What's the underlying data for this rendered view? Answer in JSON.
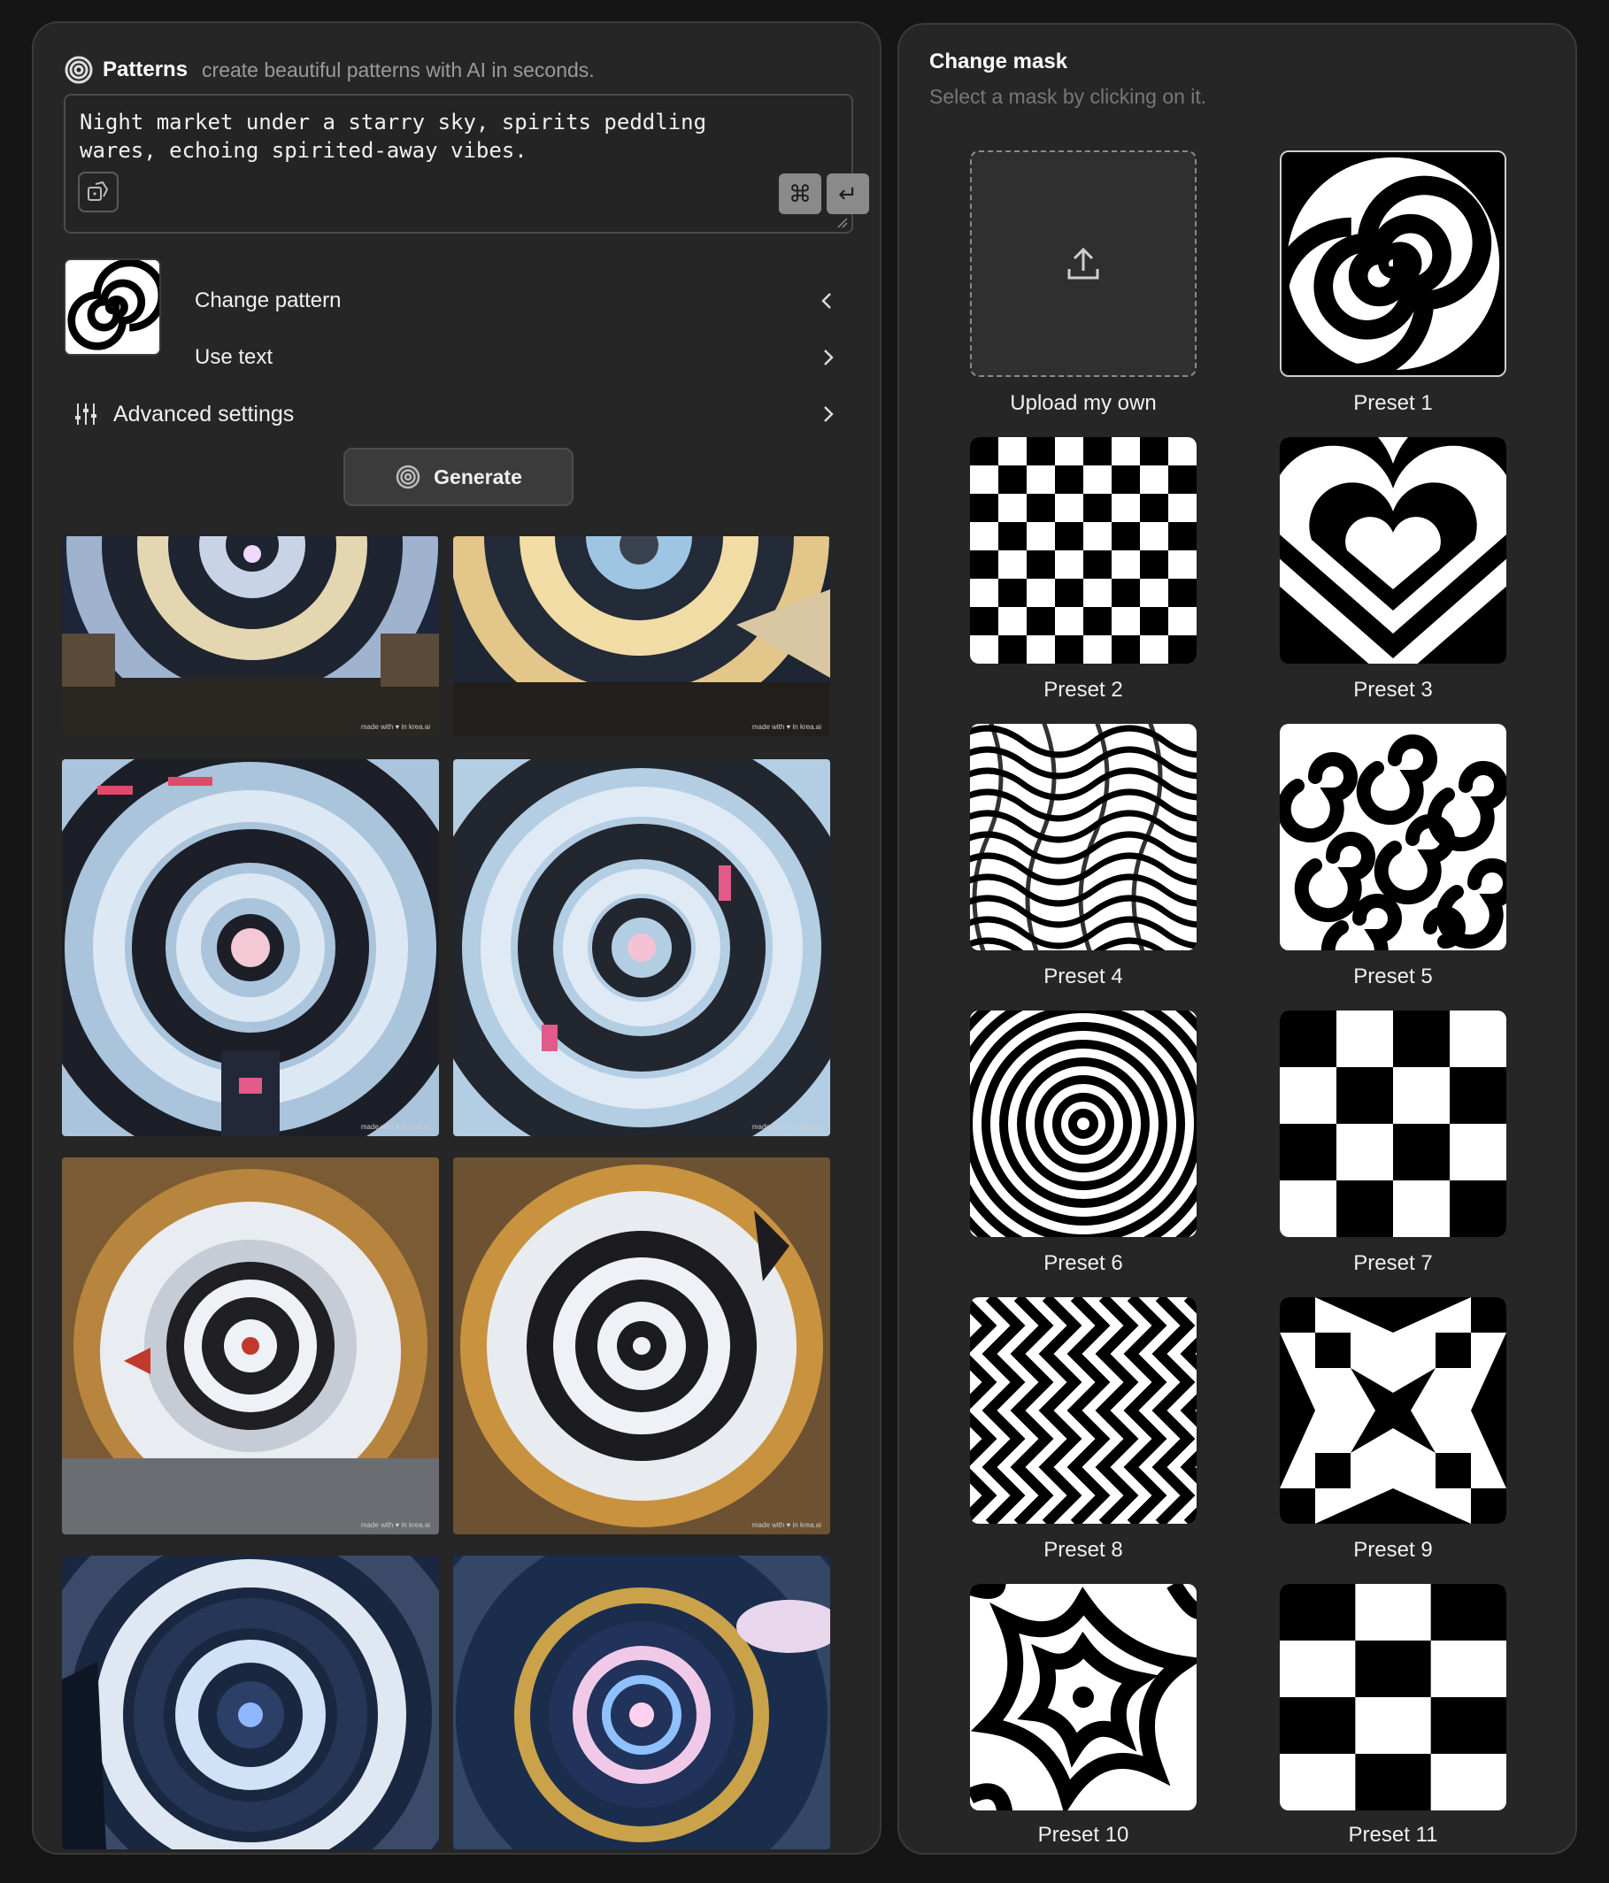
{
  "header": {
    "title": "Patterns",
    "subtitle": "create beautiful patterns with AI in seconds."
  },
  "prompt": {
    "value": "Night market under a starry sky, spirits peddling\nwares, echoing spirited-away vibes."
  },
  "shortcut": {
    "cmd_glyph": "⌘",
    "return_glyph": "↵"
  },
  "options": {
    "change_pattern": "Change pattern",
    "use_text": "Use text",
    "advanced_settings": "Advanced settings"
  },
  "generate": {
    "label": "Generate"
  },
  "gallery": {
    "watermark": "made with ♥ in krea.ai"
  },
  "mask_panel": {
    "title": "Change mask",
    "subtitle": "Select a mask by clicking on it.",
    "upload_label": "Upload my own",
    "presets": [
      "Preset 1",
      "Preset 2",
      "Preset 3",
      "Preset 4",
      "Preset 5",
      "Preset 6",
      "Preset 7",
      "Preset 8",
      "Preset 9",
      "Preset 10",
      "Preset 11"
    ]
  },
  "colors": {
    "accent_panel": "#262626",
    "background": "#151515"
  },
  "icons": [
    "spiral-logo-icon",
    "dice-icon",
    "command-icon",
    "return-icon",
    "chevron-left-icon",
    "chevron-right-icon",
    "sliders-icon",
    "upload-icon"
  ]
}
